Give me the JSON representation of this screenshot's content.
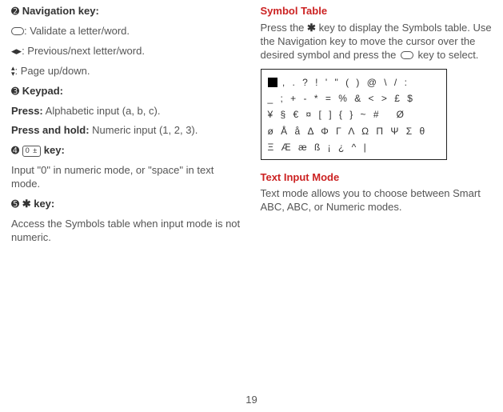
{
  "page_number": "19",
  "left": {
    "nav_heading_bullet": "➋",
    "nav_heading": "Navigation key:",
    "nav_validate": ": Validate a letter/word.",
    "nav_prevnext": ": Previous/next letter/word.",
    "nav_pageupdown": ": Page up/down.",
    "keypad_heading_bullet": "➌",
    "keypad_heading": "Keypad:",
    "press_label": "Press:",
    "press_text": " Alphabetic input (a, b, c).",
    "presshold_label": "Press and hold:",
    "presshold_text": " Numeric input (1, 2, 3).",
    "zerokey_bullet": "➍",
    "zerokey_heading": "key:",
    "zerokey_text": "Input \"0\" in numeric mode, or \"space\" in text mode.",
    "symkey_bullet": "➎",
    "symkey_heading": "key:",
    "symkey_text": "Access the Symbols table when input mode is not numeric."
  },
  "right": {
    "symbol_table_heading": "Symbol Table",
    "symbol_intro_a": "Press the ",
    "symbol_intro_b": " key to display the Symbols table. Use the Navigation key to move the cursor over the desired symbol and press the",
    "symbol_intro_c": " key to select.",
    "text_input_heading": "Text Input Mode",
    "text_input_body": "Text mode allows you to choose between Smart ABC, ABC, or Numeric modes."
  },
  "chart_data": {
    "type": "table",
    "title": "Symbols table",
    "rows": [
      [
        "■",
        ",",
        ".",
        "?",
        "!",
        "'",
        "\"",
        "(",
        ")",
        "@",
        "\\",
        "/",
        ":"
      ],
      [
        "_",
        ";",
        "+",
        "-",
        "*",
        "=",
        "%",
        "&",
        "<",
        ">",
        "£",
        "$"
      ],
      [
        "¥",
        "§",
        "€",
        "¤",
        "[",
        "]",
        "{",
        "}",
        "~",
        "#",
        "",
        "Ø"
      ],
      [
        "ø",
        "Å",
        "å",
        "Δ",
        "Φ",
        "Γ",
        "Λ",
        "Ω",
        "Π",
        "Ψ",
        "Σ",
        "θ"
      ],
      [
        "Ξ",
        "Æ",
        "æ",
        "ß",
        "¡",
        "¿",
        "^",
        "|"
      ]
    ]
  }
}
